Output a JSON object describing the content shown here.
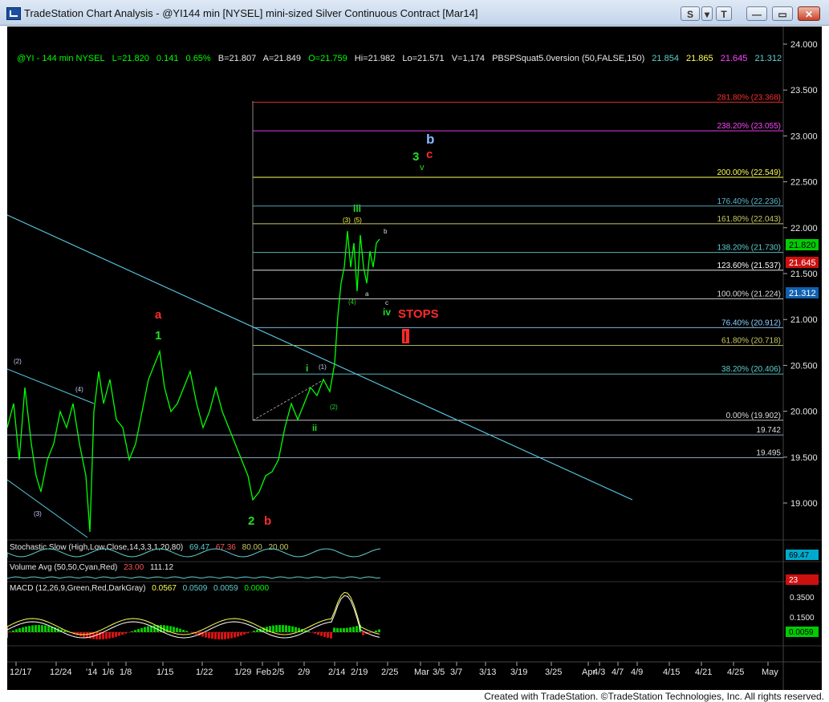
{
  "window": {
    "title": "TradeStation Chart Analysis - @YI144 min [NYSEL] mini-sized Silver Continuous Contract [Mar14]",
    "buttons": {
      "s_label": "S",
      "drop_label": "▾",
      "t_label": "T",
      "min_label": "—",
      "max_label": "▭",
      "close_label": "✕"
    }
  },
  "colors": {
    "background": "#000000",
    "price_green": "#00ff00",
    "trendline": "#56c8e0",
    "fib_red": "#ff2a2a",
    "fib_magenta": "#ff44ff",
    "fib_yellow": "#ffff44",
    "fib_teal": "#5fd0d0",
    "fib_olive": "#c8c864",
    "fib_white": "#dddddd"
  },
  "status": {
    "symbol": "@YI - 144 min  NYSEL",
    "last": "L=21.820",
    "change": "0.141",
    "pct": "0.65%",
    "bid": "B=21.807",
    "ask": "A=21.849",
    "open": "O=21.759",
    "high": "Hi=21.982",
    "low": "Lo=21.571",
    "volume": "V=1,174",
    "indicator": "PBSPSquat5.0version (50,FALSE,150)",
    "ind_v1": "21.854",
    "ind_v2": "21.865",
    "ind_v3": "21.645",
    "ind_v4": "21.312"
  },
  "price_axis": {
    "ticks": [
      "24.000",
      "23.500",
      "23.000",
      "22.500",
      "22.000",
      "21.500",
      "21.000",
      "20.500",
      "20.000",
      "19.500",
      "19.000"
    ],
    "last_value": "21.820",
    "marker_red": "21.645",
    "marker_blue": "21.312"
  },
  "fib_levels": [
    {
      "pct": "281.80%",
      "value": "23.368",
      "price": 23.368,
      "color": "#ff3030"
    },
    {
      "pct": "238.20%",
      "value": "23.055",
      "price": 23.055,
      "color": "#ff44ff"
    },
    {
      "pct": "200.00%",
      "value": "22.549",
      "price": 22.549,
      "color": "#ffff55"
    },
    {
      "pct": "176.40%",
      "value": "22.236",
      "price": 22.236,
      "color": "#5fb8d0"
    },
    {
      "pct": "161.80%",
      "value": "22.043",
      "price": 22.043,
      "color": "#c8c864"
    },
    {
      "pct": "138.20%",
      "value": "21.730",
      "price": 21.73,
      "color": "#5fd0d0"
    },
    {
      "pct": "123.60%",
      "value": "21.537",
      "price": 21.537,
      "color": "#ffffff"
    },
    {
      "pct": "100.00%",
      "value": "21.224",
      "price": 21.224,
      "color": "#dddddd"
    },
    {
      "pct": "76.40%",
      "value": "20.912",
      "price": 20.912,
      "color": "#8fd0ff"
    },
    {
      "pct": "61.80%",
      "value": "20.718",
      "price": 20.718,
      "color": "#c8c864"
    },
    {
      "pct": "38.20%",
      "value": "20.406",
      "price": 20.406,
      "color": "#5fd0d0"
    },
    {
      "pct": "0.00%",
      "value": "19.902",
      "price": 19.902,
      "color": "#dddddd"
    }
  ],
  "plain_levels": [
    {
      "label": "19.742",
      "price": 19.742
    },
    {
      "label": "19.495",
      "price": 19.495
    }
  ],
  "wave_labels": {
    "a_red": "a",
    "one_green": "1",
    "two_green": "2",
    "b_red": "b",
    "three_green": "3",
    "c_red": "c",
    "b_blue": "b",
    "v_green": "v",
    "iii_green": "iii",
    "iv_green": "iv",
    "i_green": "i",
    "ii_green": "ii",
    "stops": "STOPS",
    "small": {
      "p2": "(2)",
      "p4": "(4)",
      "p3": "(3)",
      "p1b": "(1)",
      "p2b": "(2)",
      "p3b": "(3)",
      "p5b": "(5)",
      "p4b": "(4)",
      "a": "a",
      "b": "b",
      "c": "c"
    }
  },
  "stochastic": {
    "label": "Stochastic Slow (High,Low,Close,14,3,3,1,20,80)",
    "k": "69.47",
    "d": "67.36",
    "ob": "80.00",
    "os": "20.00",
    "axis": "69.47"
  },
  "volume": {
    "label": "Volume Avg (50,50,Cyan,Red)",
    "v1": "23.00",
    "v2": "111.12",
    "axis": "23"
  },
  "macd": {
    "label": "MACD (12,26,9,Green,Red,DarkGray)",
    "v1": "0.0567",
    "v2": "0.0509",
    "v3": "0.0059",
    "v4": "0.0000",
    "ticks": [
      "0.3500",
      "0.1500"
    ],
    "axis": "0.0059"
  },
  "date_axis": [
    "12/17",
    "12/24",
    "'14",
    "1/6",
    "1/8",
    "1/15",
    "1/22",
    "1/29",
    "Feb",
    "2/5",
    "2/9",
    "2/14",
    "2/19",
    "2/25",
    "Mar",
    "3/5",
    "3/7",
    "3/13",
    "3/19",
    "3/25",
    "Apr",
    "4/3",
    "4/7",
    "4/9",
    "4/15",
    "4/21",
    "4/25",
    "May"
  ],
  "footer": "Created with TradeStation. ©TradeStation Technologies, Inc. All rights reserved."
}
